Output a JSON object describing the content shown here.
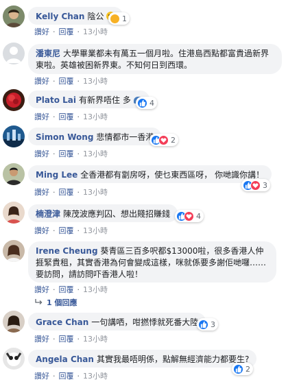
{
  "actions": {
    "like": "讚好",
    "reply": "回覆"
  },
  "comments": [
    {
      "author": "Kelly Chan",
      "text": "陰公",
      "time": "13小時",
      "reactions": "1",
      "reaction_types": [
        "wow"
      ]
    },
    {
      "author": "潘東尼",
      "text": "大學畢業都未有萬五一個月啦。住港島西點都富貴過新界東啦。英雄被困新界東。不知何日到西環。",
      "time": "13小時",
      "reactions": "",
      "reaction_types": []
    },
    {
      "author": "Plato Lai",
      "text": "有新界唔住 多",
      "time": "13小時",
      "reactions": "4",
      "reaction_types": [
        "like"
      ]
    },
    {
      "author": "Simon Wong",
      "text": "悲情都市一香港",
      "time": "13小時",
      "reactions": "2",
      "reaction_types": [
        "like",
        "love"
      ]
    },
    {
      "author": "Ming Lee",
      "text": "全香港都有劏房呀，使乜東西區呀， 你哋識你講！",
      "time": "13小時",
      "reactions": "3",
      "reaction_types": [
        "like",
        "love"
      ]
    },
    {
      "author": "楠澄津",
      "text": "陳茂波應判囚、想出賤招賺錢",
      "time": "13小時",
      "reactions": "4",
      "reaction_types": [
        "like",
        "love"
      ]
    },
    {
      "author": "Irene Cheung",
      "text": "葵青區三百多呎都$13000啦，很多香港人仲捱緊貴租，其實香港為何會變成這樣，咪就係要多謝佢哋囉……要訪問，請訪問吓香港人啦！",
      "time": "13小時",
      "reactions": "",
      "reaction_types": []
    },
    {
      "author": "Grace Chan",
      "text": "一句講哂，咁撚悸就死番大陸",
      "time": "13小時",
      "reactions": "3",
      "reaction_types": [
        "like"
      ]
    },
    {
      "author": "Angela Chan",
      "text": "其實我最唔明係，點解無經濟能力都要生?",
      "time": "13小時",
      "reactions": "2",
      "reaction_types": [
        "like"
      ]
    }
  ],
  "replies_link": "1 個回應",
  "colors": {
    "author": "#385898",
    "bubble": "#f2f3f5",
    "like": "#1877f2",
    "love": "#f33e58",
    "wow": "#f7b125"
  }
}
